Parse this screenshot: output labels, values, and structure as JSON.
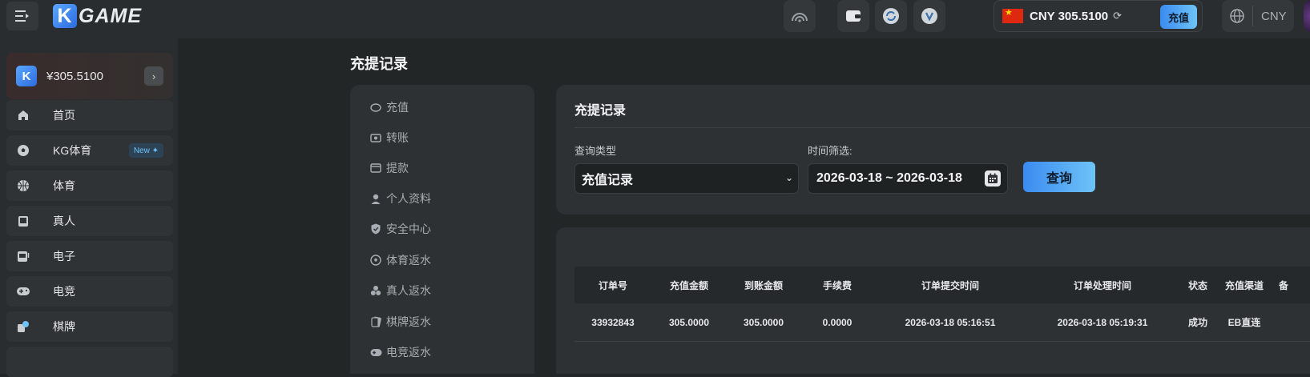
{
  "header": {
    "logo_text": "GAME",
    "logo_mark": "K",
    "wallet": {
      "currency_amount": "CNY 305.5100",
      "deposit_label": "充值"
    },
    "lang_currency": "CNY"
  },
  "sidebar": {
    "balance": {
      "mark": "K",
      "amount": "¥305.5100"
    },
    "items": [
      {
        "label": "首页",
        "icon": "home-icon"
      },
      {
        "label": "KG体育",
        "icon": "soccer-icon",
        "badge": "New ✦"
      },
      {
        "label": "体育",
        "icon": "basketball-icon"
      },
      {
        "label": "真人",
        "icon": "cards-icon"
      },
      {
        "label": "电子",
        "icon": "slot-machine-icon"
      },
      {
        "label": "电竞",
        "icon": "gamepad-icon"
      },
      {
        "label": "棋牌",
        "icon": "chess-icon"
      }
    ]
  },
  "page": {
    "title": "充提记录"
  },
  "submenu": {
    "items": [
      {
        "label": "充值",
        "icon": "piggy-bank-icon"
      },
      {
        "label": "转账",
        "icon": "transfer-icon"
      },
      {
        "label": "提款",
        "icon": "withdraw-icon"
      },
      {
        "label": "个人资料",
        "icon": "user-icon"
      },
      {
        "label": "安全中心",
        "icon": "shield-icon"
      },
      {
        "label": "体育返水",
        "icon": "soccer-icon"
      },
      {
        "label": "真人返水",
        "icon": "chips-icon"
      },
      {
        "label": "棋牌返水",
        "icon": "card-icon"
      },
      {
        "label": "电竞返水",
        "icon": "gamepad-icon"
      }
    ]
  },
  "filter": {
    "title": "充提记录",
    "type_label": "查询类型",
    "type_value": "充值记录",
    "time_label": "时间筛选:",
    "date_range": "2026-03-18 ~ 2026-03-18",
    "query_label": "查询"
  },
  "table": {
    "headers": [
      "订单号",
      "充值金额",
      "到账金额",
      "手续费",
      "订单提交时间",
      "订单处理时间",
      "状态",
      "充值渠道",
      "备"
    ],
    "rows": [
      [
        "33932843",
        "305.0000",
        "305.0000",
        "0.0000",
        "2026-03-18 05:16:51",
        "2026-03-18 05:19:31",
        "成功",
        "EB直连",
        ""
      ]
    ]
  },
  "colors": {
    "accent_start": "#3a8bf0",
    "accent_end": "#6ec3f7",
    "background": "#232627",
    "panel": "#2e3133"
  }
}
